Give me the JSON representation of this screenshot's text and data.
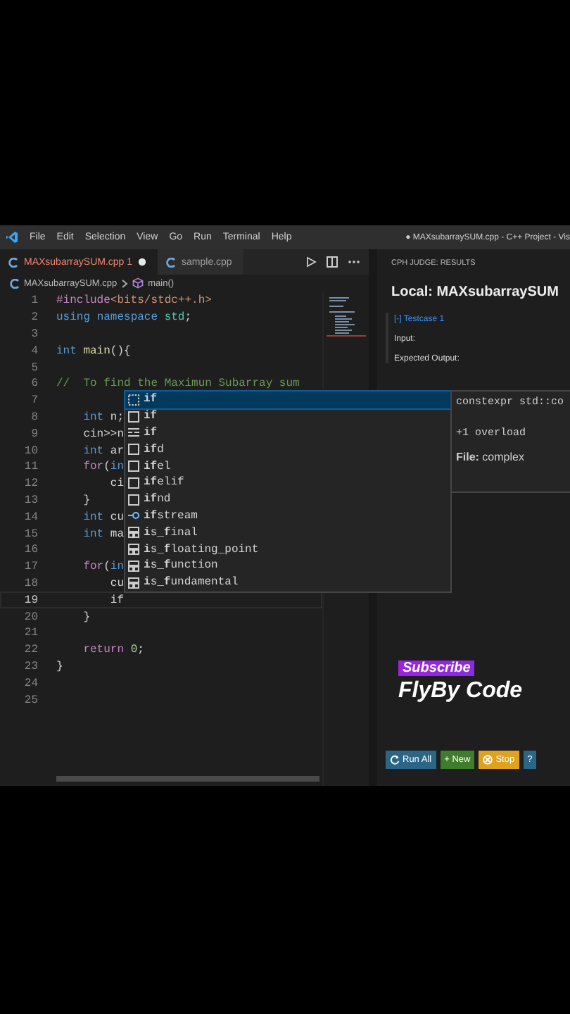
{
  "title_bar": {
    "menus": [
      "File",
      "Edit",
      "Selection",
      "View",
      "Go",
      "Run",
      "Terminal",
      "Help"
    ],
    "title": "● MAXsubarraySUM.cpp - C++ Project - Vis"
  },
  "tabs": [
    {
      "label": "MAXsubarraySUM.cpp",
      "badge": "1",
      "selected": true,
      "modified": true,
      "error": true
    },
    {
      "label": "sample.cpp",
      "selected": false,
      "modified": false,
      "error": false
    }
  ],
  "breadcrumb": [
    {
      "label": "MAXsubarraySUM.cpp",
      "kind": "file"
    },
    {
      "label": "main()",
      "kind": "function"
    }
  ],
  "editor": {
    "lines": [
      {
        "number": "1",
        "current": false,
        "tokens": [
          {
            "kind": "pp",
            "text": "#include"
          },
          {
            "kind": "str",
            "text": "<bits/stdc++.h>"
          }
        ]
      },
      {
        "number": "2",
        "current": false,
        "tokens": [
          {
            "kind": "kw",
            "text": "using"
          },
          {
            "kind": "kw",
            "text": " namespace"
          },
          {
            "kind": "type",
            "text": " std"
          },
          {
            "kind": "plain",
            "text": ";"
          }
        ]
      },
      {
        "number": "3",
        "current": false
      },
      {
        "number": "4",
        "current": false,
        "tokens": [
          {
            "kind": "kw",
            "text": "int"
          },
          {
            "kind": "fn",
            "text": " main"
          },
          {
            "kind": "plain",
            "text": "(){"
          }
        ]
      },
      {
        "number": "5",
        "current": false
      },
      {
        "number": "6",
        "current": false,
        "tokens": [
          {
            "kind": "cm",
            "text": "//  To find the Maximun Subarray sum"
          }
        ]
      },
      {
        "number": "7",
        "current": false
      },
      {
        "number": "8",
        "current": false,
        "tokens": [
          {
            "kind": "kw",
            "text": "    int"
          },
          {
            "kind": "plain",
            "text": " n;"
          }
        ]
      },
      {
        "number": "9",
        "current": false,
        "tokens": [
          {
            "kind": "plain",
            "text": "    cin>>n"
          }
        ]
      },
      {
        "number": "10",
        "current": false,
        "tokens": [
          {
            "kind": "kw",
            "text": "    int"
          },
          {
            "kind": "plain",
            "text": " ar"
          }
        ]
      },
      {
        "number": "11",
        "current": false,
        "tokens": [
          {
            "kind": "ctrl",
            "text": "    for"
          },
          {
            "kind": "plain",
            "text": "("
          },
          {
            "kind": "kw",
            "text": "in"
          }
        ]
      },
      {
        "number": "12",
        "current": false,
        "tokens": [
          {
            "kind": "plain",
            "text": "        ci"
          }
        ]
      },
      {
        "number": "13",
        "current": false,
        "tokens": [
          {
            "kind": "plain",
            "text": "    }"
          }
        ]
      },
      {
        "number": "14",
        "current": false,
        "tokens": [
          {
            "kind": "kw",
            "text": "    int"
          },
          {
            "kind": "plain",
            "text": " cu"
          }
        ]
      },
      {
        "number": "15",
        "current": false,
        "tokens": [
          {
            "kind": "kw",
            "text": "    int"
          },
          {
            "kind": "plain",
            "text": " ma"
          }
        ]
      },
      {
        "number": "16",
        "current": false
      },
      {
        "number": "17",
        "current": false,
        "tokens": [
          {
            "kind": "ctrl",
            "text": "    for"
          },
          {
            "kind": "plain",
            "text": "("
          },
          {
            "kind": "kw",
            "text": "in"
          }
        ]
      },
      {
        "number": "18",
        "current": false,
        "tokens": [
          {
            "kind": "plain",
            "text": "        cu"
          }
        ]
      },
      {
        "number": "19",
        "current": true,
        "tokens": [
          {
            "kind": "plain",
            "text": "        if"
          }
        ]
      },
      {
        "number": "20",
        "current": false,
        "tokens": [
          {
            "kind": "plain",
            "text": "    }"
          }
        ]
      },
      {
        "number": "21",
        "current": false
      },
      {
        "number": "22",
        "current": false,
        "tokens": [
          {
            "kind": "ctrl",
            "text": "    return"
          },
          {
            "kind": "num",
            "text": " 0"
          },
          {
            "kind": "plain",
            "text": ";"
          }
        ]
      },
      {
        "number": "23",
        "current": false,
        "tokens": [
          {
            "kind": "plain",
            "text": "}"
          }
        ]
      },
      {
        "number": "24",
        "current": false
      },
      {
        "number": "25",
        "current": false
      }
    ]
  },
  "suggestions": {
    "items": [
      {
        "label": "**if**",
        "kind": "snippet",
        "selected": true
      },
      {
        "label": "**if**",
        "kind": "template",
        "selected": false
      },
      {
        "label": "**if**",
        "kind": "keyword",
        "selected": false
      },
      {
        "label": "**if**d",
        "kind": "template",
        "selected": false
      },
      {
        "label": "**if**el",
        "kind": "template",
        "selected": false
      },
      {
        "label": "**if**elif",
        "kind": "template",
        "selected": false
      },
      {
        "label": "**if**nd",
        "kind": "template",
        "selected": false
      },
      {
        "label": "**if**stream",
        "kind": "reference",
        "selected": false
      },
      {
        "label": "**i**s_**f**inal",
        "kind": "struct",
        "selected": false
      },
      {
        "label": "**i**s_**f**loating_point",
        "kind": "struct",
        "selected": false
      },
      {
        "label": "**i**s_**f**unction",
        "kind": "struct",
        "selected": false
      },
      {
        "label": "**i**s_**f**undamental",
        "kind": "struct",
        "selected": false
      }
    ],
    "details": {
      "signature": "constexpr std::co",
      "overloads": "+1 overload",
      "file": "**File:** complex"
    }
  },
  "cph": {
    "header": "CPH JUDGE: RESULTS",
    "title": "Local: MAXsubarraySUM",
    "testcase": "[-] Testcase 1",
    "input_label": "Input:",
    "expected_label": "Expected Output:",
    "buttons": [
      {
        "label": "Run All",
        "kind": "run"
      },
      {
        "label": "+ New",
        "kind": "new"
      },
      {
        "label": "Stop",
        "kind": "stop"
      },
      {
        "label": "?",
        "kind": "help"
      }
    ]
  },
  "overlay": {
    "badge": "Subscribe",
    "channel": "FlyBy Code"
  }
}
